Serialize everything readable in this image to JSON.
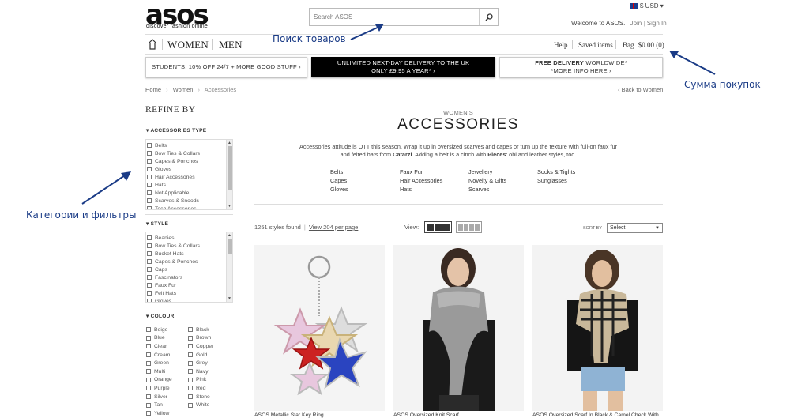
{
  "header": {
    "logo_text": "asos",
    "logo_tagline": "discover fashion online",
    "search_placeholder": "Search ASOS",
    "currency": "$ USD ▾",
    "welcome": "Welcome to ASOS.",
    "join": "Join",
    "sign_in": "Sign In",
    "divider": "|"
  },
  "nav": {
    "women": "WOMEN",
    "men": "MEN",
    "help": "Help",
    "saved_items": "Saved items",
    "bag_label": "Bag",
    "bag_total": "$0.00 (0)"
  },
  "banners": {
    "students": "STUDENTS: 10% OFF 24/7 + MORE GOOD STUFF ›",
    "delivery_line1": "UNLIMITED NEXT-DAY DELIVERY TO THE UK",
    "delivery_line2": "ONLY £9.95 A YEAR* ›",
    "free_line1_bold": "FREE DELIVERY",
    "free_line1_rest": " WORLDWIDE*",
    "free_line2": "*MORE INFO HERE ›"
  },
  "breadcrumb": {
    "items": [
      "Home",
      "Women",
      "Accessories"
    ],
    "sep": "›",
    "back": "‹  Back to Women"
  },
  "sidebar": {
    "refine_by": "REFINE BY",
    "accessories_type": {
      "heading": "ACCESSORIES TYPE",
      "items": [
        "Belts",
        "Bow Ties & Collars",
        "Capes & Ponchos",
        "Gloves",
        "Hair Accessories",
        "Hats",
        "Not Applicable",
        "Scarves & Snoods",
        "Tech Accessories"
      ]
    },
    "style": {
      "heading": "STYLE",
      "items": [
        "Beanies",
        "Bow Ties & Collars",
        "Bucket Hats",
        "Capes & Ponchos",
        "Caps",
        "Fascinators",
        "Faux Fur",
        "Felt Hats",
        "Gloves"
      ]
    },
    "colour": {
      "heading": "COLOUR",
      "col1": [
        "Beige",
        "Blue",
        "Clear",
        "Cream",
        "Green",
        "Multi",
        "Orange",
        "Purple",
        "Silver",
        "Tan",
        "Yellow"
      ],
      "col2": [
        "Black",
        "Brown",
        "Copper",
        "Gold",
        "Grey",
        "Navy",
        "Pink",
        "Red",
        "Stone",
        "White"
      ]
    }
  },
  "main": {
    "subtitle": "WOMEN'S",
    "title": "ACCESSORIES",
    "desc_line1": "Accessories attitude is OTT this season. Wrap it up in oversized scarves and capes or turn up the texture with full-on faux fur",
    "desc_line2_a": "and felted hats from ",
    "desc_line2_b": "Catarzi",
    "desc_line2_c": ". Adding a belt is a cinch with ",
    "desc_line2_d": "Pieces'",
    "desc_line2_e": " obi and leather styles, too.",
    "categories": [
      [
        "Belts",
        "Capes",
        "Gloves"
      ],
      [
        "Faux Fur",
        "Hair Accessories",
        "Hats"
      ],
      [
        "Jewellery",
        "Novelty & Gifts",
        "Scarves"
      ],
      [
        "Socks & Tights",
        "Sunglasses"
      ]
    ],
    "styles_found": "1251 styles found",
    "view_per_page": "View 204 per page",
    "view_label": "View:",
    "sort_by": "SORT BY",
    "sort_value": "Select",
    "products": [
      "ASOS Metallic Star Key Ring",
      "ASOS Oversized Knit Scarf",
      "ASOS Oversized Scarf In Black & Camel Check With"
    ]
  },
  "annotations": {
    "search": "Поиск товаров",
    "total": "Сумма покупок",
    "filters": "Категории и фильтры"
  },
  "colors": {
    "annotation_blue": "#1a3b86",
    "banner_black": "#000000"
  }
}
